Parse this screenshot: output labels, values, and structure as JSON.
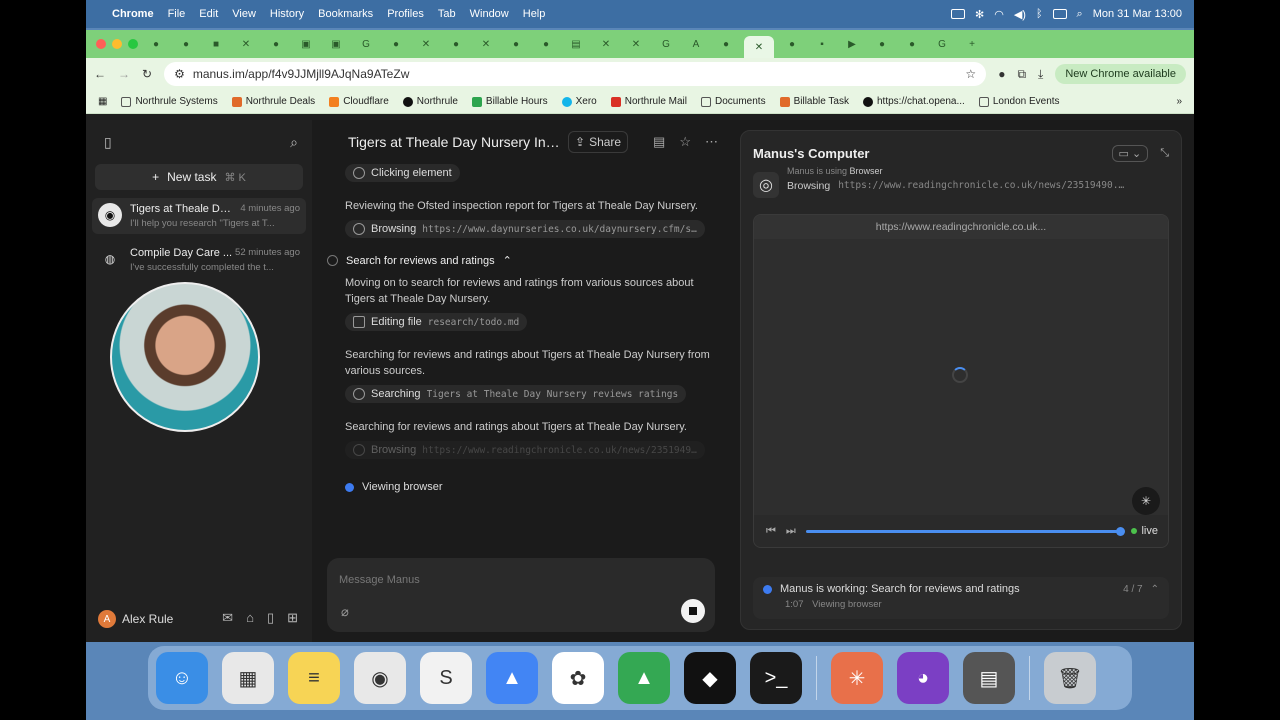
{
  "menubar": {
    "app": "Chrome",
    "items": [
      "File",
      "Edit",
      "View",
      "History",
      "Bookmarks",
      "Profiles",
      "Tab",
      "Window",
      "Help"
    ],
    "clock": "Mon 31 Mar  13:00"
  },
  "browser": {
    "url": "manus.im/app/f4v9JJMjll9AJqNa9ATeZw",
    "new_chrome": "New Chrome available",
    "bookmarks": [
      "Northrule Systems",
      "Northrule Deals",
      "Cloudflare",
      "Northrule",
      "Billable Hours",
      "Xero",
      "Northrule Mail",
      "Documents",
      "Billable Task",
      "https://chat.opena...",
      "London Events"
    ],
    "bookmark_colors": [
      "#555",
      "#e06a2a",
      "#f38020",
      "#111",
      "#2da44e",
      "#13b5ea",
      "#d93025",
      "#555",
      "#e06a2a",
      "#111",
      "#555"
    ]
  },
  "sidebar": {
    "new_task": "New task",
    "shortcut": "⌘  K",
    "tasks": [
      {
        "title": "Tigers at Theale Da...",
        "time": "4 minutes ago",
        "sub": "I'll help you research \"Tigers at T..."
      },
      {
        "title": "Compile Day Care ...",
        "time": "52 minutes ago",
        "sub": "I've successfully completed the t..."
      }
    ],
    "user": "Alex Rule",
    "avatar_letter": "A"
  },
  "main": {
    "title": "Tigers at Theale Day Nursery Inf...",
    "share": "Share",
    "items": {
      "pill_click": "Clicking element",
      "para1": "Reviewing the Ofsted inspection report for Tigers at Theale Day Nursery.",
      "pill_browse_label": "Browsing",
      "pill_browse_url": "https://www.daynurseries.co.uk/daynursery.cfm/searc...",
      "step": "Search for reviews and ratings",
      "para2": "Moving on to search for reviews and ratings from various sources about Tigers at Theale Day Nursery.",
      "pill_edit_label": "Editing file",
      "pill_edit_path": "research/todo.md",
      "para3": "Searching for reviews and ratings about Tigers at Theale Day Nursery from various sources.",
      "pill_search_label": "Searching",
      "pill_search_query": "Tigers at Theale Day Nursery reviews ratings",
      "para4": "Searching for reviews and ratings about Tigers at Theale Day Nursery.",
      "pill_browse2_label": "Browsing",
      "pill_browse2_url": "https://www.readingchronicle.co.uk/news/23519490.ti...",
      "viewing": "Viewing browser"
    },
    "message_placeholder": "Message Manus"
  },
  "computer": {
    "title": "Manus's Computer",
    "using_prefix": "Manus is using",
    "using_tool": "Browser",
    "detail_label": "Browsing",
    "detail_url": "https://www.readingchronicle.co.uk/news/23519490.tigers-...",
    "viewer_url": "https://www.readingchronicle.co.uk...",
    "live": "live",
    "progress": 1.0,
    "status_text": "Manus is working: Search for reviews and ratings",
    "status_count": "4 / 7",
    "status_time": "1:07",
    "status_sub": "Viewing browser"
  },
  "dock": {
    "apps": [
      "finder-icon",
      "launchpad-icon",
      "notes-icon",
      "chrome-icon",
      "scrivener-icon",
      "google-ads-icon",
      "chatgpt-icon",
      "google-ads-2-icon",
      "unity-icon",
      "terminal-icon",
      "claude-icon",
      "github-icon",
      "calculator-icon",
      "trash-icon"
    ],
    "colors": [
      "#3a8ee6",
      "#e8e8e8",
      "#f7d455",
      "#e8e8e8",
      "#f2f2f2",
      "#4285f4",
      "#ffffff",
      "#34a853",
      "#111111",
      "#1a1a1a",
      "#e8704a",
      "#7b3fc4",
      "#555555",
      "#c8ccd0"
    ]
  }
}
